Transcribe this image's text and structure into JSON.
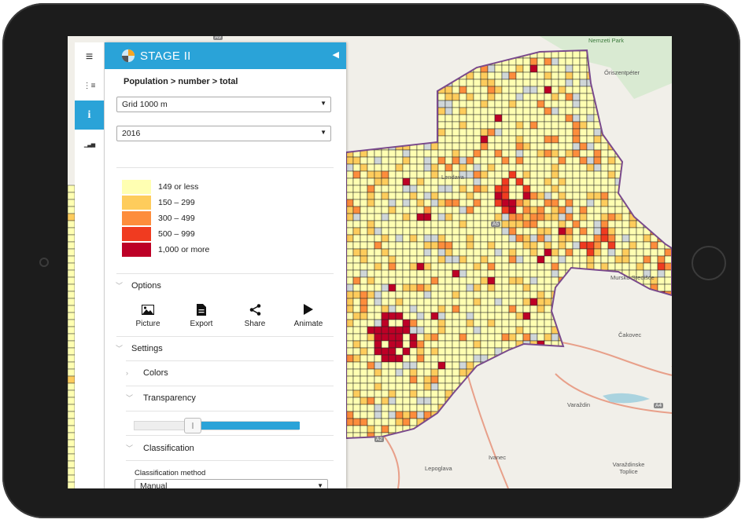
{
  "app": {
    "title": "STAGE II",
    "collapse_icon": "chevron-left-icon"
  },
  "iconbar": [
    {
      "name": "menu-icon",
      "glyph": "≡"
    },
    {
      "name": "layer-tree-icon",
      "glyph": "⋮≡"
    },
    {
      "name": "info-icon",
      "glyph": "i",
      "active": true
    },
    {
      "name": "bar-chart-icon",
      "glyph": "▁▃▅"
    }
  ],
  "breadcrumb": "Population > number > total",
  "grid_select": {
    "value": "Grid 1000 m"
  },
  "year_select": {
    "value": "2016"
  },
  "legend": [
    {
      "label": "149 or less",
      "color": "#ffffb2"
    },
    {
      "label": "150 – 299",
      "color": "#fecc5c"
    },
    {
      "label": "300 – 499",
      "color": "#fd8d3c"
    },
    {
      "label": "500 – 999",
      "color": "#f03b20"
    },
    {
      "label": "1,000 or more",
      "color": "#bd0026"
    }
  ],
  "options": {
    "label": "Options",
    "tools": [
      {
        "label": "Picture",
        "icon": "picture-icon"
      },
      {
        "label": "Export",
        "icon": "export-icon"
      },
      {
        "label": "Share",
        "icon": "share-icon"
      },
      {
        "label": "Animate",
        "icon": "play-icon"
      }
    ]
  },
  "settings": {
    "label": "Settings",
    "colors": "Colors",
    "transparency": "Transparency",
    "transparency_value": 0.35,
    "classification": "Classification",
    "classification_method_label": "Classification method",
    "classification_method_value": "Manual"
  },
  "map_labels": [
    "Nemzeti Park",
    "Őriszentpéter",
    "Lendava",
    "Mursko Središće",
    "Čakovec",
    "Varaždin",
    "Ivanec",
    "Lepoglava",
    "Varaždinske Toplice",
    "A9",
    "A5",
    "A2",
    "A4"
  ],
  "accent_color": "#2aa3d8"
}
